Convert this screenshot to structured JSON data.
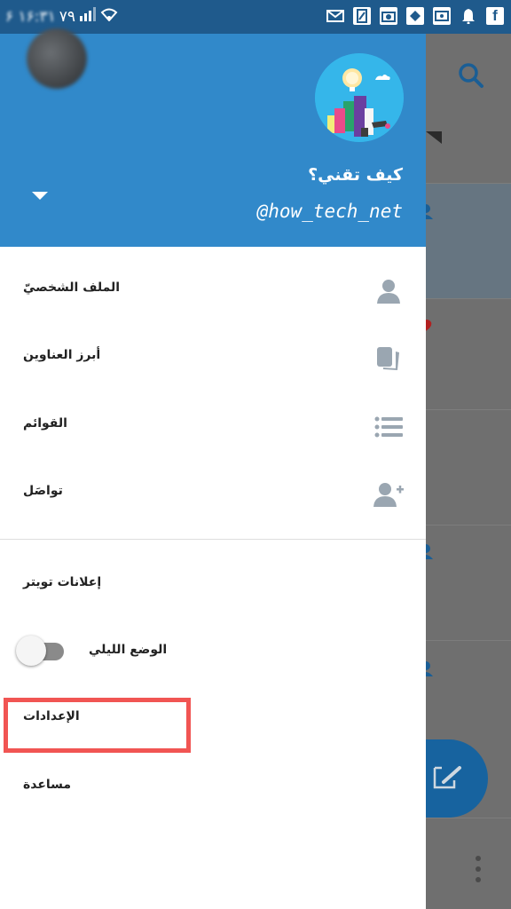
{
  "statusbar": {
    "time": "٧٩",
    "left_prefix": "۶ ۱۶:۳۱",
    "icons": [
      "mail-icon",
      "sim-icon",
      "camera-icon",
      "app-icon",
      "chat-icon",
      "bell-icon",
      "facebook-icon"
    ]
  },
  "drawer": {
    "display_name": "كيف تقني؟",
    "handle": "@how_tech_net",
    "menu": [
      {
        "label": "الملف الشخصيّ",
        "icon": "person-icon"
      },
      {
        "label": "أبرز العناوين",
        "icon": "cards-icon"
      },
      {
        "label": "القوائم",
        "icon": "list-icon"
      },
      {
        "label": "تواصَل",
        "icon": "add-person-icon"
      }
    ],
    "secondary": {
      "ads": "إعلانات تويتر",
      "night_mode": "الوضع الليلي",
      "night_mode_on": false,
      "settings": "الإعدادات",
      "help": "مساعدة"
    }
  },
  "colors": {
    "header": "#3189ca",
    "statusbar": "#1f5a8c",
    "accent": "#1da1f2",
    "highlight": "#f15553",
    "icon_gray": "#9aa6b1"
  }
}
